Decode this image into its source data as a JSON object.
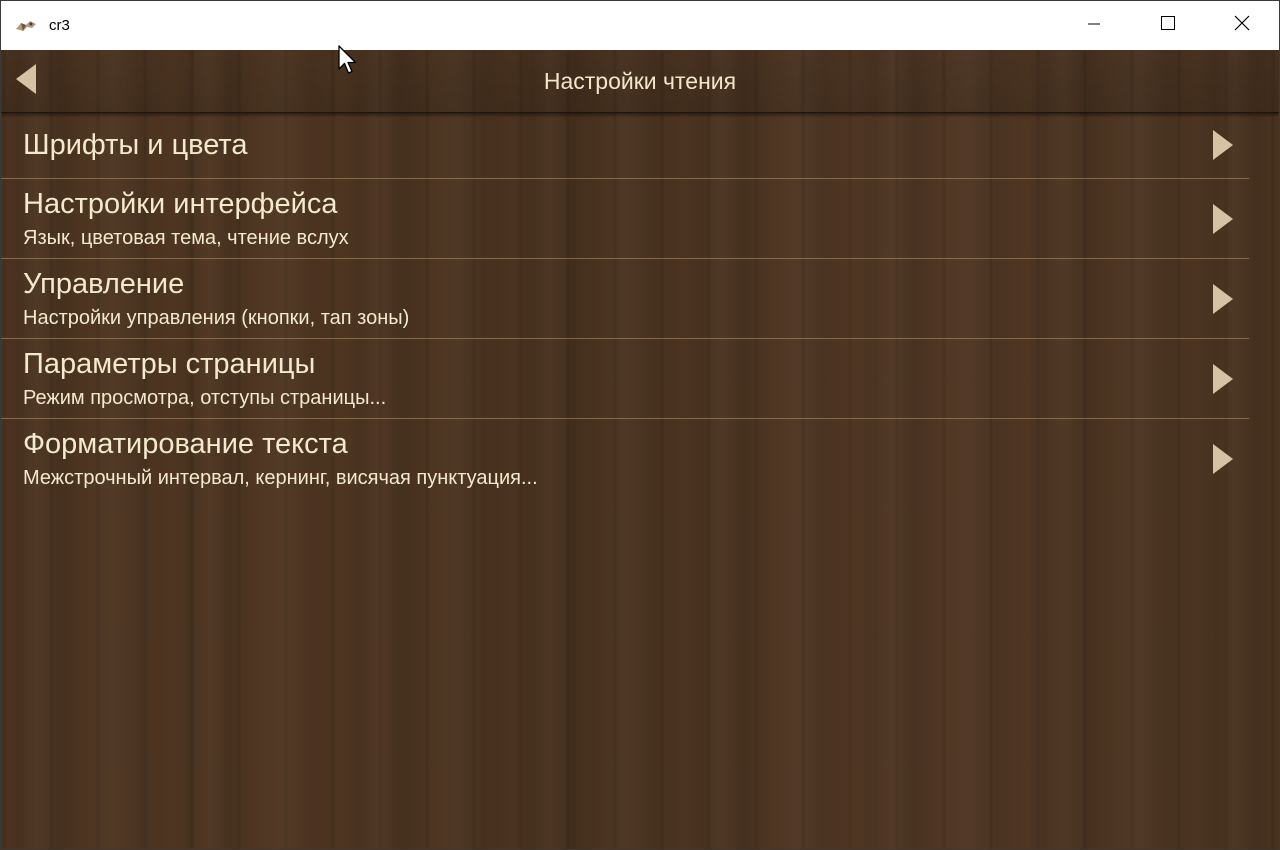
{
  "window": {
    "title": "cr3",
    "icons": {
      "app": "app-icon",
      "minimize": "minimize-icon",
      "maximize": "maximize-icon",
      "close": "close-icon"
    }
  },
  "header": {
    "title": "Настройки чтения",
    "back_icon": "back-arrow-icon"
  },
  "items": [
    {
      "title": "Шрифты и цвета",
      "subtitle": ""
    },
    {
      "title": "Настройки интерфейса",
      "subtitle": "Язык, цветовая тема, чтение вслух"
    },
    {
      "title": "Управление",
      "subtitle": "Настройки управления (кнопки, тап зоны)"
    },
    {
      "title": "Параметры страницы",
      "subtitle": "Режим просмотра, отступы страницы..."
    },
    {
      "title": "Форматирование текста",
      "subtitle": "Межстрочный интервал, кернинг, висячая пунктуация..."
    }
  ],
  "colors": {
    "text": "#f3e9cc",
    "wood": "#4a3320",
    "arrow": "#d6c3a6"
  }
}
